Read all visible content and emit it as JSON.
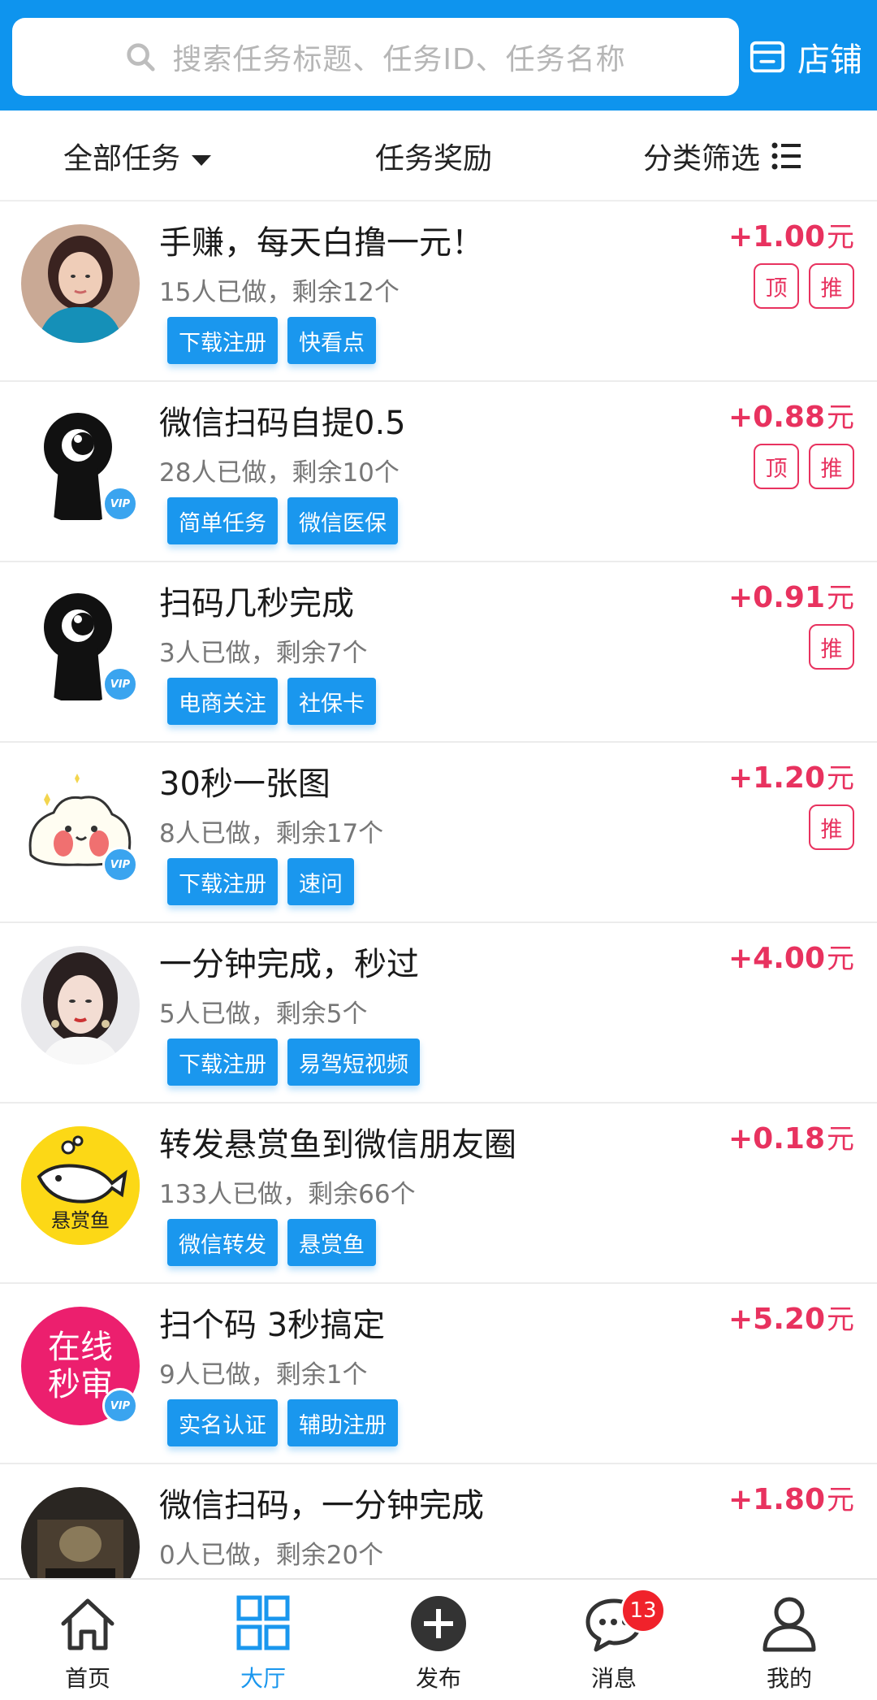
{
  "search": {
    "placeholder": "搜索任务标题、任务ID、任务名称"
  },
  "header": {
    "shop_label": "店铺"
  },
  "filters": {
    "all_tasks": "全部任务",
    "reward": "任务奖励",
    "category": "分类筛选"
  },
  "tasks": [
    {
      "title": "手赚，每天白撸一元！",
      "stats": "15人已做，剩余12个",
      "tags": [
        "下载注册",
        "快看点"
      ],
      "reward": "+1.00",
      "unit": "元",
      "badges": [
        "顶",
        "推"
      ],
      "avatar": "girl-photo",
      "vip": false
    },
    {
      "title": "微信扫码自提0.5",
      "stats": "28人已做，剩余10个",
      "tags": [
        "简单任务",
        "微信医保"
      ],
      "reward": "+0.88",
      "unit": "元",
      "badges": [
        "顶",
        "推"
      ],
      "avatar": "keyhole-eye",
      "vip": true
    },
    {
      "title": "扫码几秒完成",
      "stats": "3人已做，剩余7个",
      "tags": [
        "电商关注",
        "社保卡"
      ],
      "reward": "+0.91",
      "unit": "元",
      "badges": [
        "推"
      ],
      "avatar": "keyhole-eye",
      "vip": true
    },
    {
      "title": "30秒一张图",
      "stats": "8人已做，剩余17个",
      "tags": [
        "下载注册",
        "速问"
      ],
      "reward": "+1.20",
      "unit": "元",
      "badges": [
        "推"
      ],
      "avatar": "cartoon-blob",
      "vip": true
    },
    {
      "title": "一分钟完成，秒过",
      "stats": "5人已做，剩余5个",
      "tags": [
        "下载注册",
        "易驾短视频"
      ],
      "reward": "+4.00",
      "unit": "元",
      "badges": [],
      "avatar": "woman-photo",
      "vip": false
    },
    {
      "title": "转发悬赏鱼到微信朋友圈",
      "stats": "133人已做，剩余66个",
      "tags": [
        "微信转发",
        "悬赏鱼"
      ],
      "reward": "+0.18",
      "unit": "元",
      "badges": [],
      "avatar": "fish-logo",
      "avatar_text": "悬赏鱼",
      "vip": false
    },
    {
      "title": "扫个码 3秒搞定",
      "stats": "9人已做，剩余1个",
      "tags": [
        "实名认证",
        "辅助注册"
      ],
      "reward": "+5.20",
      "unit": "元",
      "badges": [],
      "avatar": "text-logo",
      "avatar_text_1": "在线",
      "avatar_text_2": "秒审",
      "vip": true
    },
    {
      "title": "微信扫码，一分钟完成",
      "stats": "0人已做，剩余20个",
      "tags": [],
      "reward": "+1.80",
      "unit": "元",
      "badges": [],
      "avatar": "dark-photo",
      "vip": false
    }
  ],
  "vip_label": "VIP",
  "nav": {
    "home": "首页",
    "hall": "大厅",
    "publish": "发布",
    "messages": "消息",
    "messages_badge": "13",
    "mine": "我的"
  },
  "colors": {
    "primary": "#0e94ee",
    "reward": "#e8325f",
    "tag": "#1a97ee",
    "badge_red": "#f0222b"
  }
}
